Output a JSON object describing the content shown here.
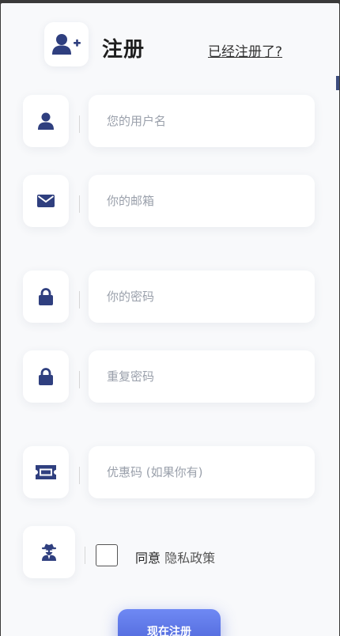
{
  "header": {
    "title": "注册",
    "login_link": "已经注册了?"
  },
  "fields": {
    "username": {
      "placeholder": "您的用户名",
      "value": ""
    },
    "email": {
      "placeholder": "你的邮箱",
      "value": ""
    },
    "password": {
      "placeholder": "你的密码",
      "value": ""
    },
    "repeat_password": {
      "placeholder": "重复密码",
      "value": ""
    },
    "coupon": {
      "placeholder": "优惠码 (如果你有)",
      "value": ""
    }
  },
  "agreement": {
    "agree_text": "同意",
    "policy_link": "隐私政策",
    "checked": false
  },
  "submit": {
    "label": "现在注册"
  },
  "icons": {
    "logo": "user-plus-icon",
    "username": "user-icon",
    "email": "envelope-icon",
    "password": "lock-icon",
    "repeat_password": "lock-icon",
    "coupon": "ticket-icon",
    "agreement": "user-secret-icon"
  },
  "colors": {
    "icon": "#2f3f7f",
    "button_top": "#6f89f4",
    "button_bottom": "#4d65d8",
    "background": "#f8f9fb"
  }
}
